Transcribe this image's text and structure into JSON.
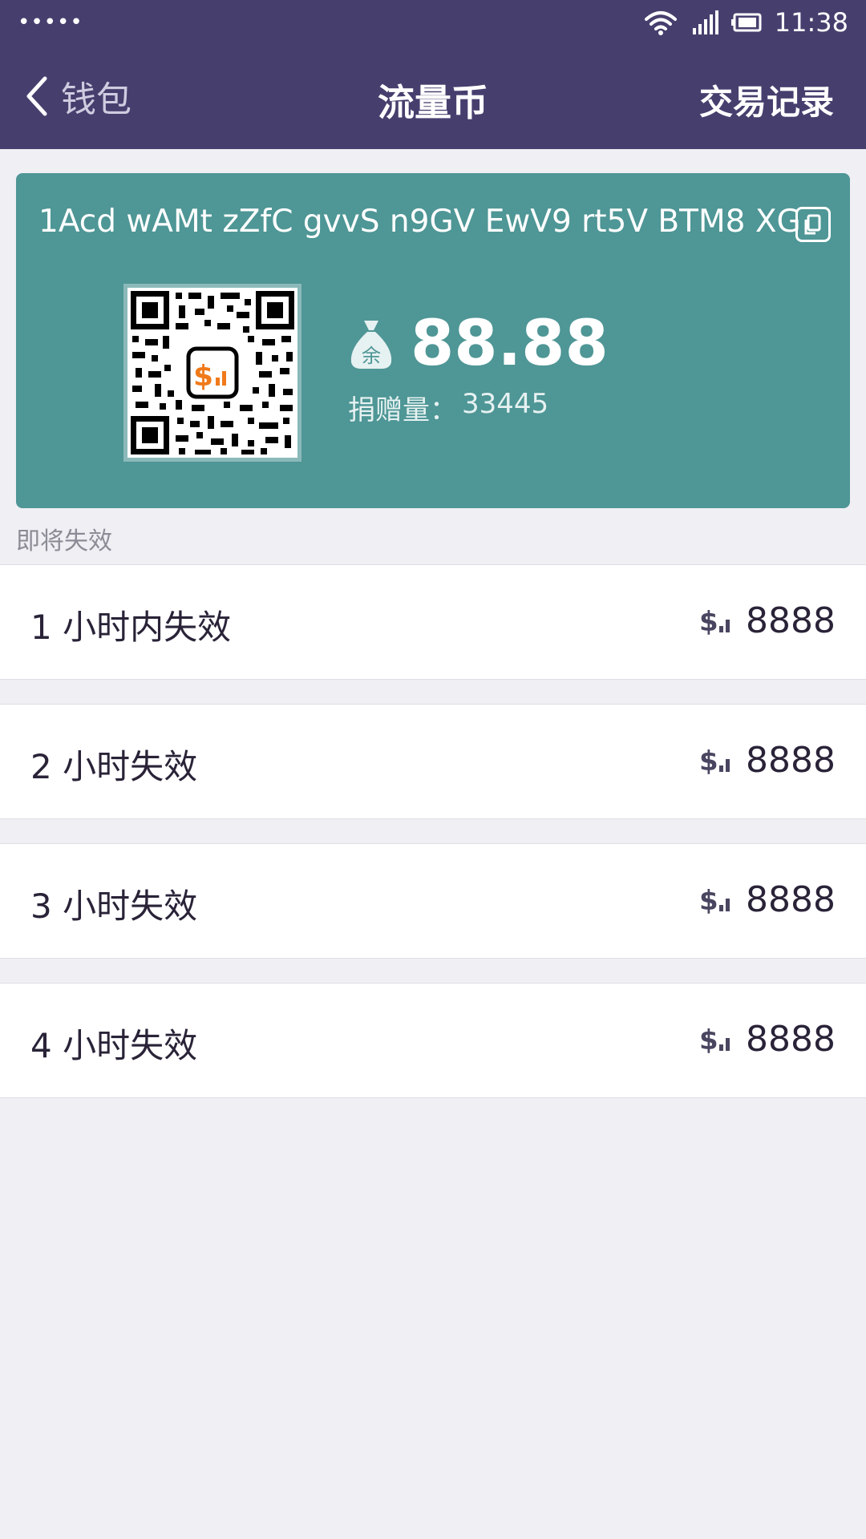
{
  "status_bar": {
    "signal_dots": "•••••",
    "time": "11:38"
  },
  "nav": {
    "back_label": "钱包",
    "title": "流量币",
    "action_label": "交易记录"
  },
  "wallet": {
    "address": "1Acd wAMt zZfC gvvS n9GV EwV9 rt5V BTM8 XG",
    "balance": "88.88",
    "balance_badge": "余",
    "donation_label": "捐赠量：",
    "donation_value": "33445"
  },
  "section_label": "即将失效",
  "expiry_items": [
    {
      "label": "1 小时内失效",
      "amount": "8888"
    },
    {
      "label": "2 小时失效",
      "amount": "8888"
    },
    {
      "label": "3 小时失效",
      "amount": "8888"
    },
    {
      "label": "4 小时失效",
      "amount": "8888"
    }
  ],
  "colors": {
    "header": "#463f6e",
    "card": "#4f9696",
    "qr_logo": "#f07a1a",
    "background": "#efeff4"
  }
}
